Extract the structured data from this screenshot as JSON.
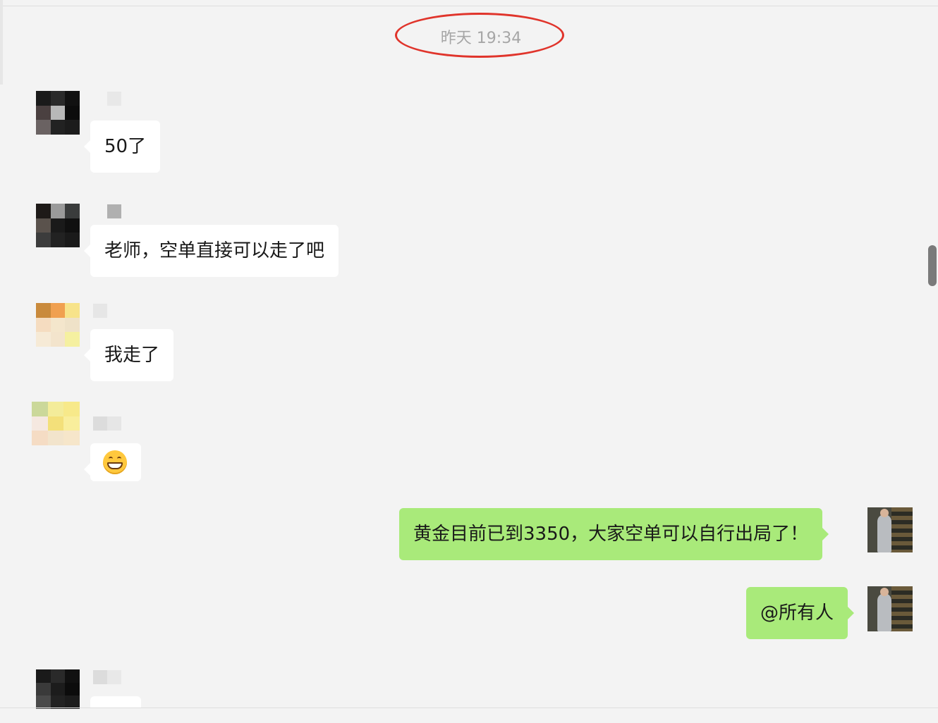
{
  "timestamp": "昨天 19:34",
  "annotation_color": "#e0342b",
  "messages": [
    {
      "side": "left",
      "text": "50了"
    },
    {
      "side": "left",
      "text": "老师，空单直接可以走了吧"
    },
    {
      "side": "left",
      "text": "我走了"
    },
    {
      "side": "left",
      "text": "",
      "emoji": "grinning-face"
    },
    {
      "side": "right",
      "text": "黄金目前已到3350，大家空单可以自行出局了！"
    },
    {
      "side": "right",
      "text": "@所有人"
    }
  ],
  "colors": {
    "background": "#f3f3f3",
    "incoming_bubble": "#ffffff",
    "outgoing_bubble": "#a9ea7a"
  }
}
